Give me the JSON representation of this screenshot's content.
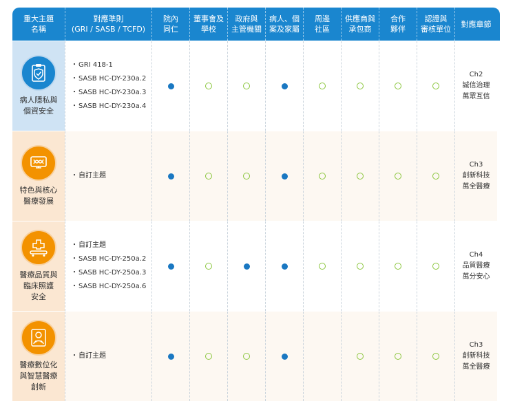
{
  "header": {
    "topic": "重大主題\n名稱",
    "criteria": "對應準則\n(GRI / SASB / TCFD)",
    "stakeholders": [
      "院內\n同仁",
      "董事會及\n學校",
      "政府與\n主管機關",
      "病人、個\n案及家屬",
      "周邊\n社區",
      "供應商與\n承包商",
      "合作\n夥伴",
      "認證與\n審核單位"
    ],
    "chapter": "對應章節"
  },
  "rows": [
    {
      "topic": "病人隱私與\n個資安全",
      "icon": "shield-privacy-icon",
      "criteria": [
        "GRI 418-1",
        "SASB HC-DY-230a.2",
        "SASB HC-DY-230a.3",
        "SASB HC-DY-230a.4"
      ],
      "marks": [
        "filled",
        "open",
        "open",
        "filled",
        "open",
        "open",
        "open",
        "open"
      ],
      "chapter": [
        "Ch2",
        "誠信治理",
        "萬眾互信"
      ]
    },
    {
      "topic": "特色與核心\n醫療發展",
      "icon": "dna-monitor-icon",
      "criteria": [
        "自訂主題"
      ],
      "marks": [
        "filled",
        "open",
        "open",
        "filled",
        "open",
        "open",
        "open",
        "open"
      ],
      "chapter": [
        "Ch3",
        "創新科技",
        "萬全醫療"
      ]
    },
    {
      "topic": "醫療品質與\n臨床照護\n安全",
      "icon": "hospital-bed-icon",
      "criteria": [
        "自訂主題",
        "SASB HC-DY-250a.2",
        "SASB HC-DY-250a.3",
        "SASB HC-DY-250a.6"
      ],
      "marks": [
        "filled",
        "open",
        "filled",
        "filled",
        "open",
        "open",
        "open",
        "open"
      ],
      "chapter": [
        "Ch4",
        "品質醫療",
        "萬分安心"
      ]
    },
    {
      "topic": "醫療數位化\n與智慧醫療\n創新",
      "icon": "doctor-tablet-icon",
      "criteria": [
        "自訂主題"
      ],
      "marks": [
        "filled",
        "open",
        "open",
        "filled",
        "none",
        "open",
        "open",
        "open"
      ],
      "chapter": [
        "Ch3",
        "創新科技",
        "萬全醫療"
      ]
    }
  ],
  "colors": {
    "header": "#1a86cf",
    "filled_dot": "#1a78c2",
    "open_dot": "#8cc63f",
    "topic_blue_bg": "#cfe3f4",
    "topic_orange_bg": "#fbe7d2",
    "icon_orange": "#f39200",
    "icon_blue": "#1a86cf"
  }
}
